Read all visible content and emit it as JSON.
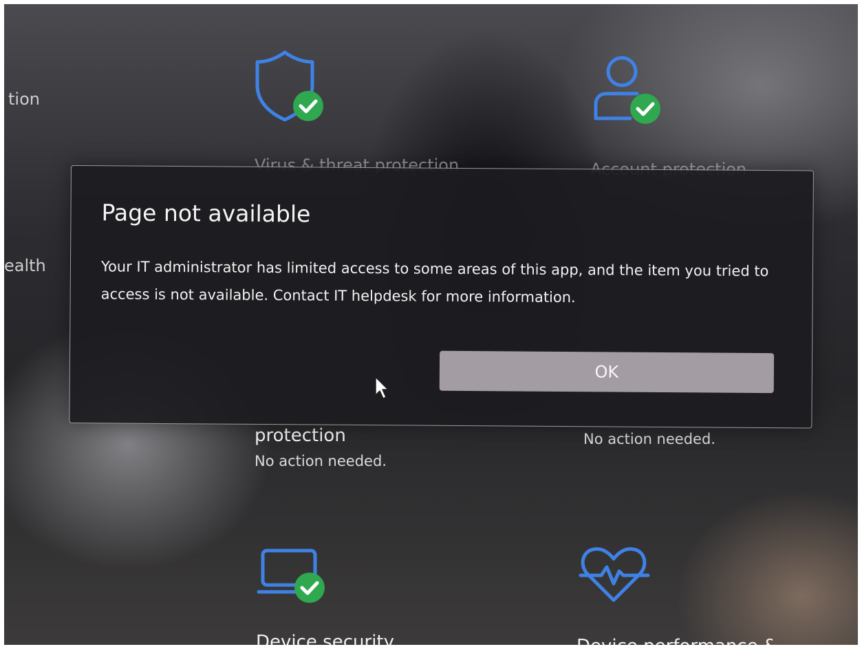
{
  "background": {
    "left_cut_top": "tion",
    "left_cut_middle": "ealth",
    "tile_virus": {
      "title": "Virus & threat protection",
      "icon": "shield-check-icon"
    },
    "tile_account": {
      "title": "Account protection",
      "icon": "person-check-icon"
    },
    "tile_firewall": {
      "title": "protection",
      "status": "No action needed."
    },
    "tile_app": {
      "status": "No action needed."
    },
    "tile_device_security": {
      "title": "Device security",
      "icon": "laptop-check-icon"
    },
    "tile_device_performance": {
      "title": "Device performance &",
      "icon": "heart-pulse-icon"
    }
  },
  "dialog": {
    "title": "Page not available",
    "message": "Your IT administrator has limited access to some areas of this app, and the item you tried to access is not available. Contact IT helpdesk for more information.",
    "ok_label": "OK"
  },
  "colors": {
    "icon_blue": "#3f82e6",
    "check_green": "#2fa84f",
    "button_bg": "#a39da3",
    "dialog_bg": "#1c1c20"
  }
}
